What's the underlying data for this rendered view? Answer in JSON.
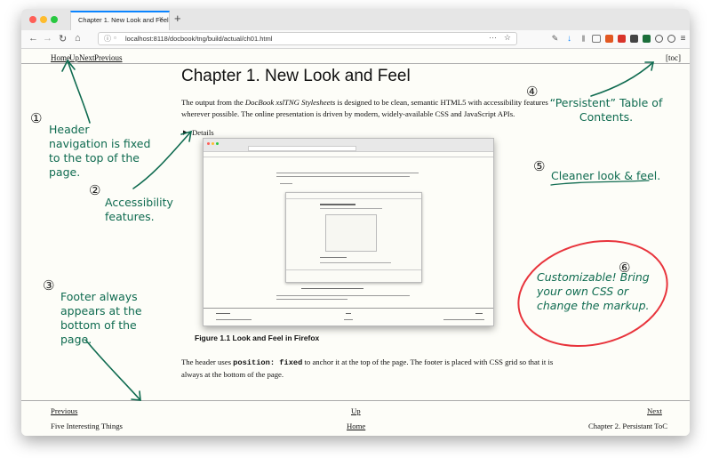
{
  "browser": {
    "tab_title": "Chapter 1. New Look and Feel",
    "tab_close": "×",
    "new_tab": "+",
    "url": "localhost:8118/docbook/tng/build/actual/ch01.html",
    "url_more": "···",
    "url_star": "☆",
    "back": "←",
    "forward": "→",
    "reload": "↻",
    "home": "⌂",
    "traffic_colors": [
      "#ff5f57",
      "#febc2e",
      "#28c840"
    ]
  },
  "header_nav": {
    "home": "Home",
    "up": "Up",
    "next": "Next",
    "previous": "Previous",
    "toc": "[toc]"
  },
  "content": {
    "chapter_title": "Chapter 1. New Look and Feel",
    "intro_before": "The output from the ",
    "intro_em": "DocBook xslTNG Stylesheets",
    "intro_after": " is designed to be clean, semantic HTML5 with accessibility features wherever possible. The online presentation is driven by modern, widely-available CSS and JavaScript APIs.",
    "details_label": "Details",
    "figure_caption": "Figure 1.1 Look and Feel in Firefox",
    "body_before": "The header uses ",
    "body_code": "position: fixed",
    "body_after": " to anchor it at the top of the page. The footer is placed with CSS grid so that it is always at the bottom of the page."
  },
  "footer_nav": {
    "previous": "Previous",
    "up": "Up",
    "next": "Next",
    "previous_title": "Five Interesting Things",
    "home": "Home",
    "next_title": "Chapter 2. Persistant ToC"
  },
  "annotations": [
    {
      "number": "①",
      "text": "Header navigation is fixed to the top of the page."
    },
    {
      "number": "②",
      "text": "Accessibility features."
    },
    {
      "number": "③",
      "text": "Footer always appears at the bottom of the page."
    },
    {
      "number": "④",
      "text": "“Persistent” Table of Contents."
    },
    {
      "number": "⑤",
      "text": "Cleaner look & feel."
    },
    {
      "number": "⑥",
      "text": "Customizable! Bring your own CSS or change the markup."
    }
  ],
  "colors": {
    "annotation_green": "#0f6b50",
    "highlight_red": "#e8343c",
    "tab_accent": "#0a84ff"
  }
}
